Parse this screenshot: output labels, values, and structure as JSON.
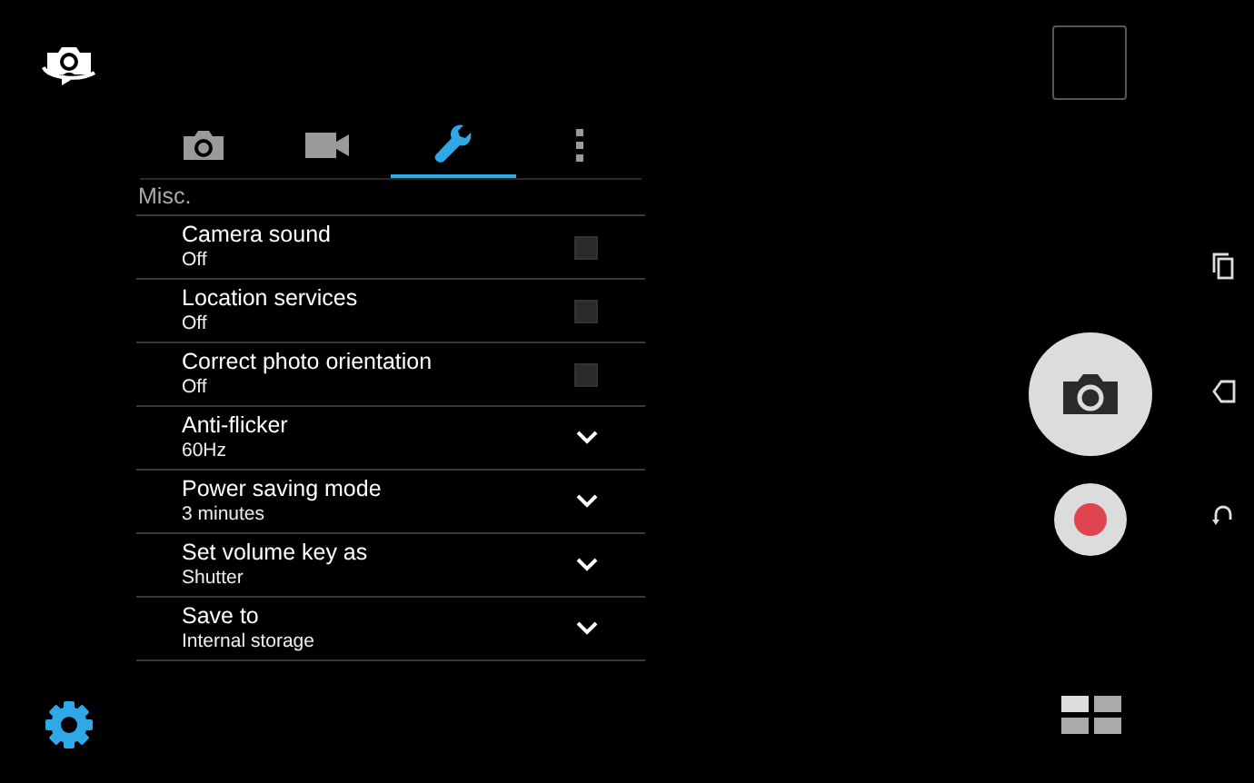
{
  "tabs": [
    {
      "kind": "photo",
      "selected": false
    },
    {
      "kind": "video",
      "selected": false
    },
    {
      "kind": "tools",
      "selected": true
    },
    {
      "kind": "more",
      "selected": false
    }
  ],
  "section_title": "Misc.",
  "settings": [
    {
      "kind": "checkbox",
      "label": "Camera sound",
      "value": "Off",
      "checked": false
    },
    {
      "kind": "checkbox",
      "label": "Location services",
      "value": "Off",
      "checked": false
    },
    {
      "kind": "checkbox",
      "label": "Correct photo orientation",
      "value": "Off",
      "checked": false
    },
    {
      "kind": "dropdown",
      "label": "Anti-flicker",
      "value": "60Hz"
    },
    {
      "kind": "dropdown",
      "label": "Power saving mode",
      "value": "3 minutes"
    },
    {
      "kind": "dropdown",
      "label": "Set volume key as",
      "value": "Shutter"
    },
    {
      "kind": "dropdown",
      "label": "Save to",
      "value": "Internal storage"
    }
  ]
}
